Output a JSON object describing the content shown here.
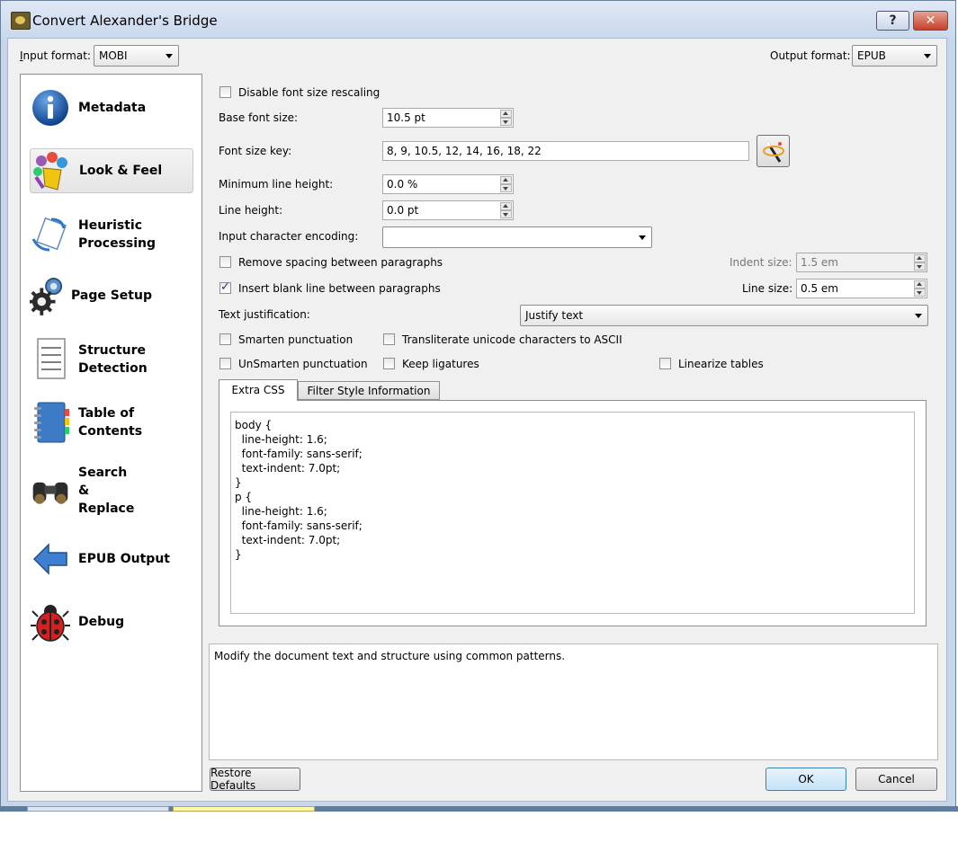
{
  "window": {
    "title": "Convert Alexander's Bridge",
    "help_label": "?",
    "close_label": "✕"
  },
  "formats": {
    "input_label": "Input format:",
    "input_value": "MOBI",
    "output_label": "Output format:",
    "output_value": "EPUB"
  },
  "sidebar": {
    "items": [
      {
        "line1": "Metadata",
        "line2": "",
        "line3": ""
      },
      {
        "line1": "Look & Feel",
        "line2": "",
        "line3": ""
      },
      {
        "line1": "Heuristic",
        "line2": "Processing",
        "line3": ""
      },
      {
        "line1": "Page Setup",
        "line2": "",
        "line3": ""
      },
      {
        "line1": "Structure",
        "line2": "Detection",
        "line3": ""
      },
      {
        "line1": "Table of",
        "line2": "Contents",
        "line3": ""
      },
      {
        "line1": "Search",
        "line2": "&",
        "line3": "Replace"
      },
      {
        "line1": "EPUB Output",
        "line2": "",
        "line3": ""
      },
      {
        "line1": "Debug",
        "line2": "",
        "line3": ""
      }
    ]
  },
  "form": {
    "disable_rescale": "Disable font size rescaling",
    "base_font_label": "Base font size:",
    "base_font_value": "10.5 pt",
    "font_key_label": "Font size key:",
    "font_key_value": "8, 9, 10.5, 12, 14, 16, 18, 22",
    "min_line_label": "Minimum line height:",
    "min_line_value": "0.0 %",
    "line_height_label": "Line height:",
    "line_height_value": "0.0 pt",
    "encoding_label": "Input character encoding:",
    "encoding_value": "",
    "remove_spacing": "Remove spacing between paragraphs",
    "indent_label": "Indent size:",
    "indent_value": "1.5 em",
    "insert_blank": "Insert blank line between paragraphs",
    "line_size_label": "Line size:",
    "line_size_value": "0.5 em",
    "justify_label": "Text justification:",
    "justify_value": "Justify text",
    "smarten": "Smarten punctuation",
    "transliterate": "Transliterate unicode characters to ASCII",
    "unsmarten": "UnSmarten punctuation",
    "ligatures": "Keep ligatures",
    "linearize": "Linearize tables"
  },
  "tabs": {
    "extra_css": "Extra CSS",
    "filter_style": "Filter Style Information"
  },
  "css_text": "body {\n  line-height: 1.6;\n  font-family: sans-serif;\n  text-indent: 7.0pt;\n}\np {\n  line-height: 1.6;\n  font-family: sans-serif;\n  text-indent: 7.0pt;\n}",
  "help_text": "Modify the document text and structure using common patterns.",
  "buttons": {
    "restore": "Restore Defaults",
    "ok": "OK",
    "cancel": "Cancel"
  }
}
